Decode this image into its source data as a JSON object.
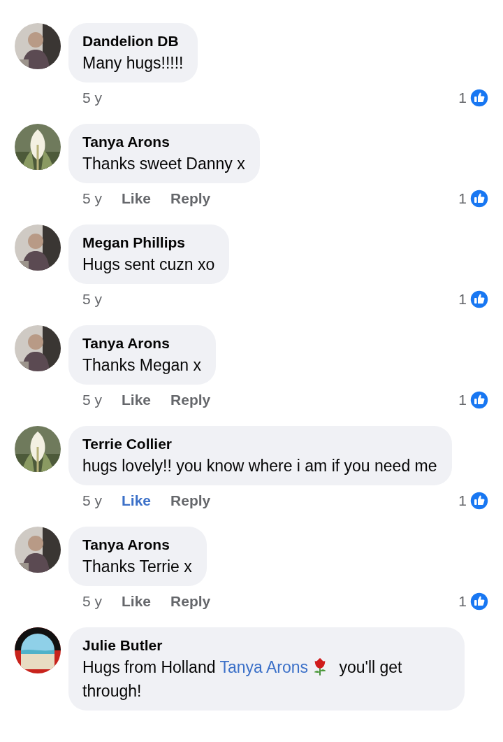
{
  "comments": [
    {
      "author": "Dandelion DB",
      "parts": [
        {
          "kind": "text",
          "text": "Many hugs!!!!!"
        }
      ],
      "time": "5 y",
      "like_count": "1"
    },
    {
      "author": "Tanya Arons",
      "parts": [
        {
          "kind": "text",
          "text": "Thanks sweet Danny x"
        }
      ],
      "time": "5 y",
      "like": {
        "label": "Like",
        "selected": false
      },
      "reply": "Reply",
      "like_count": "1"
    },
    {
      "author": "Megan Phillips",
      "parts": [
        {
          "kind": "text",
          "text": "Hugs sent cuzn xo"
        }
      ],
      "time": "5 y",
      "like_count": "1"
    },
    {
      "author": "Tanya Arons",
      "parts": [
        {
          "kind": "text",
          "text": "Thanks Megan x"
        }
      ],
      "time": "5 y",
      "like": {
        "label": "Like",
        "selected": false
      },
      "reply": "Reply",
      "like_count": "1"
    },
    {
      "author": "Terrie Collier",
      "parts": [
        {
          "kind": "text",
          "text": "hugs lovely!! you know where i am if you need me"
        }
      ],
      "time": "5 y",
      "like": {
        "label": "Like",
        "selected": true
      },
      "reply": "Reply",
      "like_count": "1"
    },
    {
      "author": "Tanya Arons",
      "parts": [
        {
          "kind": "text",
          "text": "Thanks Terrie x"
        }
      ],
      "time": "5 y",
      "like": {
        "label": "Like",
        "selected": false
      },
      "reply": "Reply",
      "like_count": "1"
    },
    {
      "author": "Julie Butler",
      "parts": [
        {
          "kind": "text",
          "text": "Hugs from Holland "
        },
        {
          "kind": "mention",
          "text": "Tanya Arons"
        },
        {
          "kind": "rose"
        },
        {
          "kind": "text",
          "text": " you'll get through!"
        }
      ]
    }
  ]
}
